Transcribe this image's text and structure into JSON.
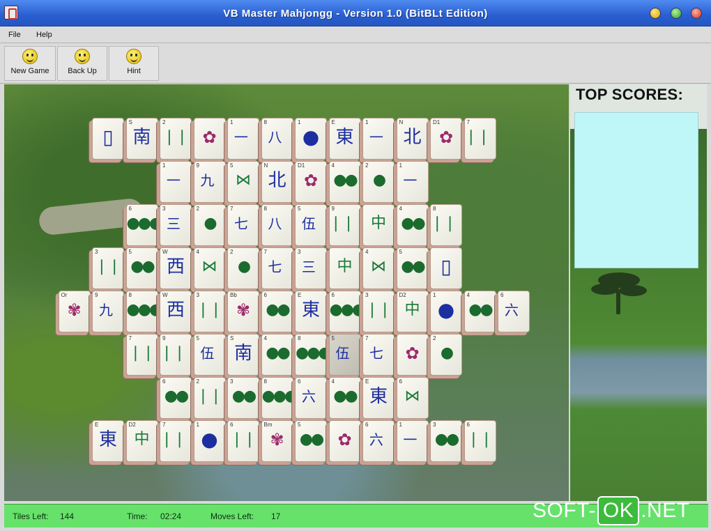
{
  "window": {
    "title": "VB Master Mahjongg - Version 1.0 (BitBLt Edition)"
  },
  "menu": {
    "file": "File",
    "help": "Help"
  },
  "toolbar": {
    "new_game": "New Game",
    "back_up": "Back Up",
    "hint": "Hint",
    "button_icon": "smiley-icon"
  },
  "scores": {
    "heading": "TOP SCORES:",
    "entries": []
  },
  "status": {
    "tiles_left_label": "Tiles Left:",
    "tiles_left": "144",
    "time_label": "Time:",
    "time": "02:24",
    "moves_left_label": "Moves Left:",
    "moves_left": "17"
  },
  "watermark": {
    "pre": "SOFT-",
    "box": "OK",
    "post": ".NET"
  },
  "colors": {
    "titlebar": "#2a5fd0",
    "status_bar": "#66e26b",
    "scores_box": "#bff7f9"
  },
  "tiles": [
    {
      "row": 0,
      "col": 0,
      "suit": "dragon",
      "glyph": "▯",
      "num": ""
    },
    {
      "row": 0,
      "col": 1,
      "suit": "wind",
      "glyph": "南",
      "num": "S"
    },
    {
      "row": 0,
      "col": 2,
      "suit": "bam",
      "glyph": "❘❘",
      "num": "2"
    },
    {
      "row": 0,
      "col": 3,
      "suit": "flower",
      "glyph": "✿",
      "num": ""
    },
    {
      "row": 0,
      "col": 4,
      "suit": "char",
      "glyph": "一",
      "num": "1"
    },
    {
      "row": 0,
      "col": 5,
      "suit": "char",
      "glyph": "八",
      "num": "8"
    },
    {
      "row": 0,
      "col": 6,
      "suit": "dragon",
      "glyph": "●",
      "num": "1"
    },
    {
      "row": 0,
      "col": 7,
      "suit": "wind",
      "glyph": "東",
      "num": "E"
    },
    {
      "row": 0,
      "col": 8,
      "suit": "char",
      "glyph": "一",
      "num": "1"
    },
    {
      "row": 0,
      "col": 9,
      "suit": "wind",
      "glyph": "北",
      "num": "N"
    },
    {
      "row": 0,
      "col": 10,
      "suit": "flower",
      "glyph": "✿",
      "num": "D1"
    },
    {
      "row": 0,
      "col": 11,
      "suit": "bam",
      "glyph": "❘❘❘",
      "num": "7"
    },
    {
      "row": 1,
      "col": 2,
      "suit": "char",
      "glyph": "一",
      "num": "1"
    },
    {
      "row": 1,
      "col": 3,
      "suit": "char",
      "glyph": "九",
      "num": "9"
    },
    {
      "row": 1,
      "col": 4,
      "suit": "bam",
      "glyph": "⋈",
      "num": "5"
    },
    {
      "row": 1,
      "col": 5,
      "suit": "wind",
      "glyph": "北",
      "num": "N"
    },
    {
      "row": 1,
      "col": 6,
      "suit": "flower",
      "glyph": "✿",
      "num": "D1"
    },
    {
      "row": 1,
      "col": 7,
      "suit": "dot",
      "glyph": "●●",
      "num": "4"
    },
    {
      "row": 1,
      "col": 8,
      "suit": "dot",
      "glyph": "●",
      "num": "2"
    },
    {
      "row": 1,
      "col": 9,
      "suit": "char",
      "glyph": "一",
      "num": "1"
    },
    {
      "row": 2,
      "col": 1,
      "suit": "dot",
      "glyph": "●●●",
      "num": "6"
    },
    {
      "row": 2,
      "col": 2,
      "suit": "char",
      "glyph": "三",
      "num": "3"
    },
    {
      "row": 2,
      "col": 3,
      "suit": "dot",
      "glyph": "●",
      "num": "2"
    },
    {
      "row": 2,
      "col": 4,
      "suit": "char",
      "glyph": "七",
      "num": "7"
    },
    {
      "row": 2,
      "col": 5,
      "suit": "char",
      "glyph": "八",
      "num": "8"
    },
    {
      "row": 2,
      "col": 6,
      "suit": "char",
      "glyph": "伍",
      "num": "5"
    },
    {
      "row": 2,
      "col": 7,
      "suit": "bam",
      "glyph": "❘❘❘",
      "num": "9"
    },
    {
      "row": 2,
      "col": 8,
      "suit": "bam",
      "glyph": "中",
      "num": ""
    },
    {
      "row": 2,
      "col": 9,
      "suit": "dot",
      "glyph": "●●",
      "num": "4"
    },
    {
      "row": 2,
      "col": 10,
      "suit": "bam",
      "glyph": "❘❘❘",
      "num": "8"
    },
    {
      "row": 3,
      "col": 0,
      "suit": "bam",
      "glyph": "❘❘",
      "num": "3"
    },
    {
      "row": 3,
      "col": 1,
      "suit": "dot",
      "glyph": "●●",
      "num": "5"
    },
    {
      "row": 3,
      "col": 2,
      "suit": "wind",
      "glyph": "西",
      "num": "W"
    },
    {
      "row": 3,
      "col": 3,
      "suit": "bam",
      "glyph": "⋈",
      "num": "4"
    },
    {
      "row": 3,
      "col": 4,
      "suit": "dot",
      "glyph": "●",
      "num": "2"
    },
    {
      "row": 3,
      "col": 5,
      "suit": "char",
      "glyph": "七",
      "num": "7"
    },
    {
      "row": 3,
      "col": 6,
      "suit": "char",
      "glyph": "三",
      "num": "3"
    },
    {
      "row": 3,
      "col": 7,
      "suit": "bam",
      "glyph": "中",
      "num": ""
    },
    {
      "row": 3,
      "col": 8,
      "suit": "bam",
      "glyph": "⋈",
      "num": "4"
    },
    {
      "row": 3,
      "col": 9,
      "suit": "dot",
      "glyph": "●●",
      "num": "5"
    },
    {
      "row": 3,
      "col": 10,
      "suit": "dragon",
      "glyph": "▯",
      "num": ""
    },
    {
      "row": 4,
      "col": -1,
      "suit": "flower",
      "glyph": "✾",
      "num": "Or"
    },
    {
      "row": 4,
      "col": 0,
      "suit": "char",
      "glyph": "九",
      "num": "9"
    },
    {
      "row": 4,
      "col": 1,
      "suit": "dot",
      "glyph": "●●●",
      "num": "8"
    },
    {
      "row": 4,
      "col": 2,
      "suit": "wind",
      "glyph": "西",
      "num": "W"
    },
    {
      "row": 4,
      "col": 3,
      "suit": "bam",
      "glyph": "❘❘",
      "num": "3"
    },
    {
      "row": 4,
      "col": 4,
      "suit": "flower",
      "glyph": "✾",
      "num": "Bb"
    },
    {
      "row": 4,
      "col": 5,
      "suit": "dot",
      "glyph": "●●",
      "num": "6"
    },
    {
      "row": 4,
      "col": 6,
      "suit": "wind",
      "glyph": "東",
      "num": "E"
    },
    {
      "row": 4,
      "col": 7,
      "suit": "dot",
      "glyph": "●●●",
      "num": "6"
    },
    {
      "row": 4,
      "col": 8,
      "suit": "bam",
      "glyph": "❘❘",
      "num": "3"
    },
    {
      "row": 4,
      "col": 9,
      "suit": "bam",
      "glyph": "中",
      "num": "D2"
    },
    {
      "row": 4,
      "col": 10,
      "suit": "dragon",
      "glyph": "●",
      "num": "1"
    },
    {
      "row": 4,
      "col": 11,
      "suit": "dot",
      "glyph": "●●",
      "num": "4"
    },
    {
      "row": 4,
      "col": 12,
      "suit": "char",
      "glyph": "六",
      "num": "6"
    },
    {
      "row": 5,
      "col": 1,
      "suit": "bam",
      "glyph": "❘❘",
      "num": "7"
    },
    {
      "row": 5,
      "col": 2,
      "suit": "bam",
      "glyph": "❘❘❘",
      "num": "9"
    },
    {
      "row": 5,
      "col": 3,
      "suit": "char",
      "glyph": "伍",
      "num": "5"
    },
    {
      "row": 5,
      "col": 4,
      "suit": "wind",
      "glyph": "南",
      "num": "S"
    },
    {
      "row": 5,
      "col": 5,
      "suit": "dot",
      "glyph": "●●",
      "num": "4"
    },
    {
      "row": 5,
      "col": 6,
      "suit": "dot",
      "glyph": "●●●",
      "num": "8"
    },
    {
      "row": 5,
      "col": 7,
      "suit": "char",
      "glyph": "伍",
      "num": "5",
      "highlight": true
    },
    {
      "row": 5,
      "col": 8,
      "suit": "char",
      "glyph": "七",
      "num": "7"
    },
    {
      "row": 5,
      "col": 9,
      "suit": "flower",
      "glyph": "✿",
      "num": ""
    },
    {
      "row": 5,
      "col": 10,
      "suit": "dot",
      "glyph": "●",
      "num": "2"
    },
    {
      "row": 6,
      "col": 2,
      "suit": "dot",
      "glyph": "●●",
      "num": "6"
    },
    {
      "row": 6,
      "col": 3,
      "suit": "bam",
      "glyph": "❘❘",
      "num": "2"
    },
    {
      "row": 6,
      "col": 4,
      "suit": "dot",
      "glyph": "●●",
      "num": "3"
    },
    {
      "row": 6,
      "col": 5,
      "suit": "dot",
      "glyph": "●●●",
      "num": "8"
    },
    {
      "row": 6,
      "col": 6,
      "suit": "char",
      "glyph": "六",
      "num": "6"
    },
    {
      "row": 6,
      "col": 7,
      "suit": "dot",
      "glyph": "●●",
      "num": "4"
    },
    {
      "row": 6,
      "col": 8,
      "suit": "wind",
      "glyph": "東",
      "num": "E"
    },
    {
      "row": 6,
      "col": 9,
      "suit": "bam",
      "glyph": "⋈",
      "num": "6"
    },
    {
      "row": 7,
      "col": 0,
      "suit": "wind",
      "glyph": "東",
      "num": "E"
    },
    {
      "row": 7,
      "col": 1,
      "suit": "bam",
      "glyph": "中",
      "num": "D2"
    },
    {
      "row": 7,
      "col": 2,
      "suit": "bam",
      "glyph": "❘❘❘",
      "num": "7"
    },
    {
      "row": 7,
      "col": 3,
      "suit": "dragon",
      "glyph": "●",
      "num": "1"
    },
    {
      "row": 7,
      "col": 4,
      "suit": "bam",
      "glyph": "❘❘",
      "num": "6"
    },
    {
      "row": 7,
      "col": 5,
      "suit": "flower",
      "glyph": "✾",
      "num": "Bm"
    },
    {
      "row": 7,
      "col": 6,
      "suit": "dot",
      "glyph": "●●",
      "num": "5"
    },
    {
      "row": 7,
      "col": 7,
      "suit": "flower",
      "glyph": "✿",
      "num": ""
    },
    {
      "row": 7,
      "col": 8,
      "suit": "char",
      "glyph": "六",
      "num": "6"
    },
    {
      "row": 7,
      "col": 9,
      "suit": "char",
      "glyph": "一",
      "num": "1"
    },
    {
      "row": 7,
      "col": 10,
      "suit": "dot",
      "glyph": "●●",
      "num": "3"
    },
    {
      "row": 7,
      "col": 11,
      "suit": "bam",
      "glyph": "❘❘",
      "num": "6"
    }
  ]
}
